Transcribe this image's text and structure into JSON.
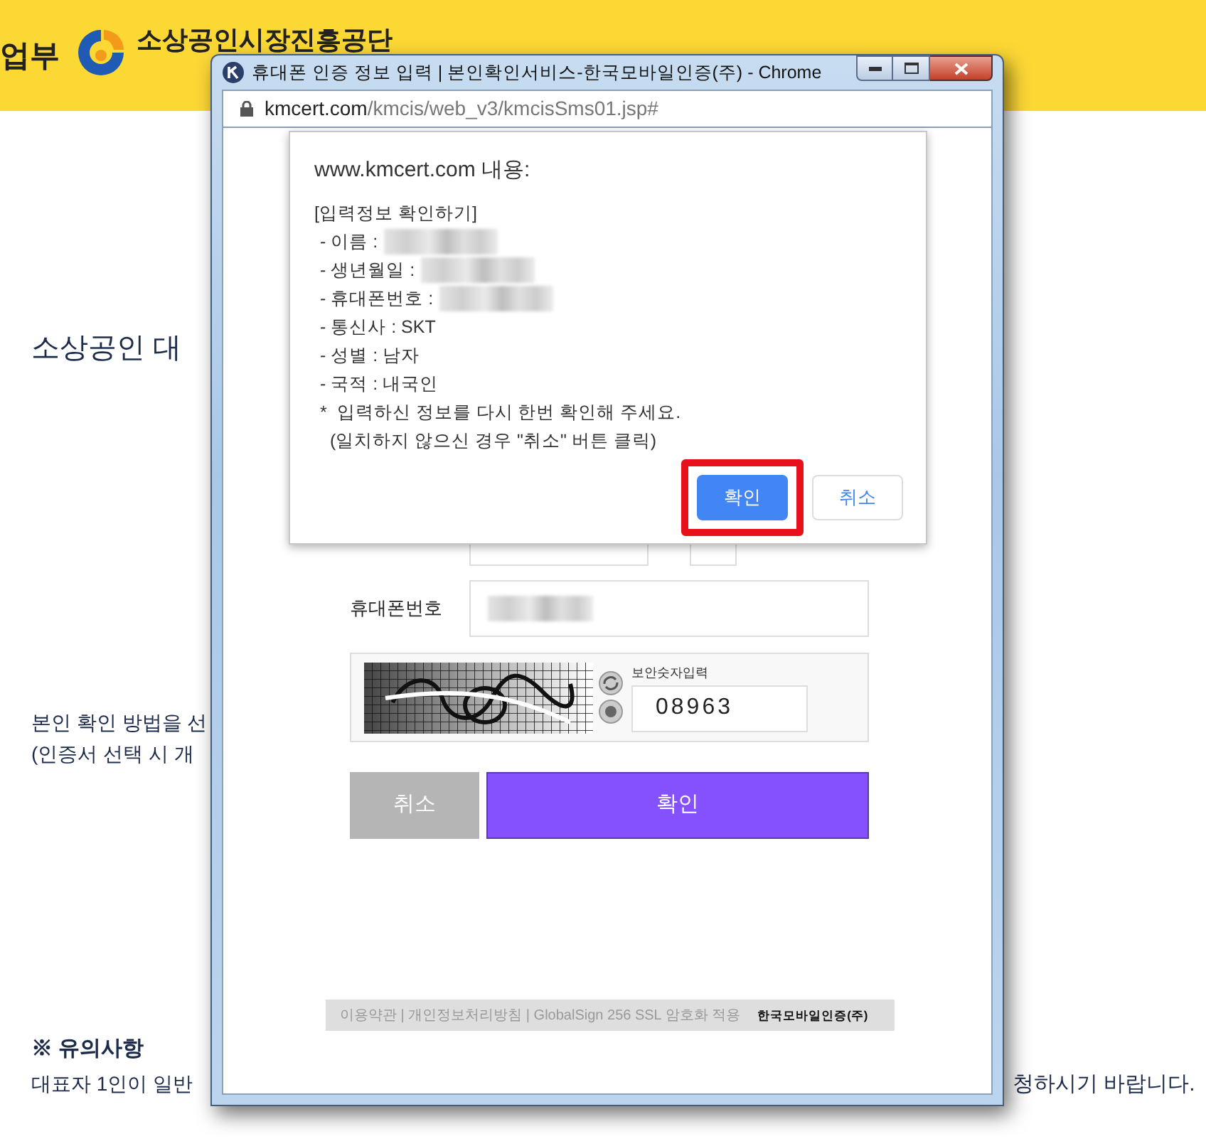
{
  "background_page": {
    "header": {
      "menu_text": "업부",
      "org_name": "소상공인시장진흥공단"
    },
    "heading": "소상공인 대",
    "instructions": [
      "본인 확인 방법을 선",
      "(인증서 선택 시 개"
    ],
    "notice_title": "※ 유의사항",
    "notice_text_left": "대표자 1인이 일반",
    "notice_text_right": "청하시기 바랍니다."
  },
  "popup": {
    "title": "휴대폰 인증 정보 입력 | 본인확인서비스-한국모바일인증(주) - Chrome",
    "url_host": "kmcert.com",
    "url_path": "/kmcis/web_v3/kmcisSms01.jsp#",
    "form": {
      "phone_label": "휴대폰번호",
      "captcha_label": "보안숫자입력",
      "captcha_value": "08963",
      "buttons": [
        {
          "label": "취소",
          "kind": "cancel"
        },
        {
          "label": "확인",
          "kind": "confirm"
        }
      ]
    },
    "footer": {
      "links": "이용약관 | 개인정보처리방침 | GlobalSign 256 SSL 암호화 적용",
      "brand": "한국모바일인증(주)"
    }
  },
  "alert": {
    "title": "www.kmcert.com 내용:",
    "heading": "[입력정보 확인하기]",
    "fields": [
      {
        "label": "- 이름 :",
        "redacted": true
      },
      {
        "label": "- 생년월일 :",
        "redacted": true
      },
      {
        "label": "- 휴대폰번호 :",
        "redacted": true
      },
      {
        "label": "- 통신사 : SKT",
        "redacted": false
      },
      {
        "label": "- 성별 : 남자",
        "redacted": false
      },
      {
        "label": "- 국적 : 내국인",
        "redacted": false
      }
    ],
    "notes": [
      "*  입력하신 정보를 다시 한번 확인해 주세요.",
      "  (일치하지 않으신 경우 \"취소\" 버튼 클릭)"
    ],
    "buttons": [
      {
        "label": "확인",
        "kind": "primary",
        "highlighted": true
      },
      {
        "label": "취소",
        "kind": "secondary",
        "highlighted": false
      }
    ]
  }
}
